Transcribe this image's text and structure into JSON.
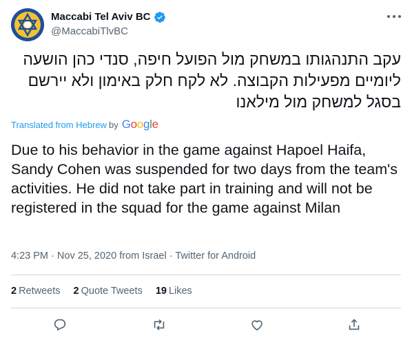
{
  "account": {
    "display_name": "Maccabi Tel Aviv BC",
    "handle": "@MaccabiTlvBC",
    "avatar_icon": "maccabi-star-logo",
    "verified_icon": "verified-badge-icon"
  },
  "tweet": {
    "text_original": "עקב התנהגותו במשחק מול הפועל חיפה, סנדי כהן הושעה ליומיים מפעילות הקבוצה. לא לקח חלק באימון ולא יירשם בסגל למשחק מול מילאנו",
    "translated_label": "Translated from Hebrew",
    "translated_by": "by",
    "translator_brand": "Google",
    "text_translated": "Due to his behavior in the game against Hapoel Haifa, Sandy Cohen was suspended for two days from the team's activities. He did not take part in training and will not be registered in the squad for the game against Milan"
  },
  "meta": {
    "time": "4:23 PM",
    "separator": "·",
    "date": "Nov 25, 2020 from Israel",
    "source": "Twitter for Android"
  },
  "stats": {
    "retweets_count": "2",
    "retweets_label": "Retweets",
    "quotes_count": "2",
    "quotes_label": "Quote Tweets",
    "likes_count": "19",
    "likes_label": "Likes"
  },
  "colors": {
    "accent": "#1d9bf0",
    "secondary_text": "#536471",
    "google_blue": "#4285F4",
    "google_red": "#EA4335",
    "google_yellow": "#FBBC05",
    "google_green": "#34A853"
  }
}
